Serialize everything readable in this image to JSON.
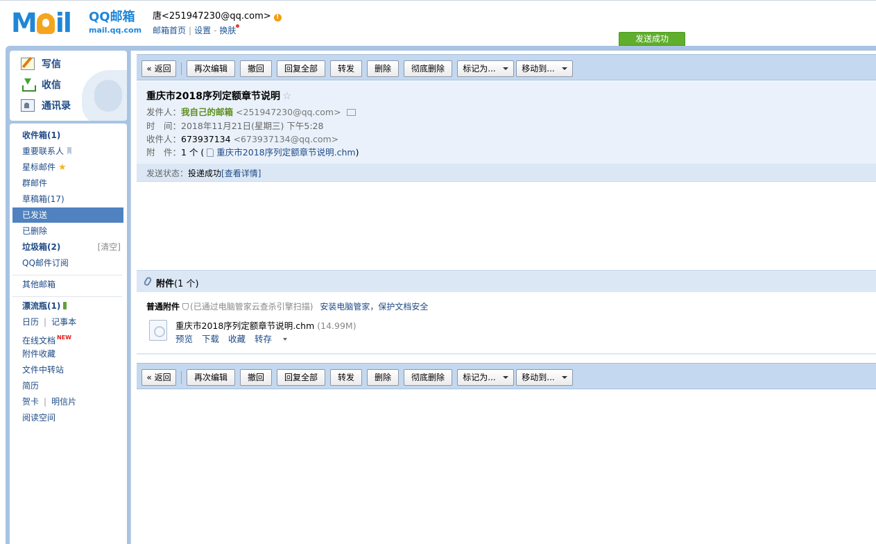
{
  "header": {
    "logo_text": "MOil",
    "brand_name": "QQ邮箱",
    "brand_domain": "mail.qq.com",
    "user": "唐<251947230@qq.com>",
    "links": [
      "邮箱首页",
      "设置",
      "换肤"
    ],
    "link_sep": "|",
    "link_dash": "-",
    "toast": "发送成功"
  },
  "sidebar": {
    "main_actions": [
      "写信",
      "收信",
      "通讯录"
    ],
    "folders": {
      "inbox": "收件箱(1)",
      "vip": "重要联系人",
      "starred": "星标邮件",
      "group": "群邮件",
      "drafts": "草稿箱(17)",
      "sent": "已发送",
      "deleted": "已删除",
      "spam": "垃圾箱(2)",
      "spam_clear": "[清空]",
      "subscribe": "QQ邮件订阅",
      "other": "其他邮箱",
      "bottle": "漂流瓶(1)",
      "calendar": "日历",
      "notes": "记事本",
      "docs": "在线文档",
      "docs_badge": "NEW",
      "att_fav": "附件收藏",
      "transfer": "文件中转站",
      "resume": "简历",
      "card": "贺卡",
      "postcard": "明信片",
      "reading": "阅读空间"
    }
  },
  "toolbar": {
    "back": "« 返回",
    "reedit": "再次编辑",
    "recall": "撤回",
    "reply_all": "回复全部",
    "forward": "转发",
    "delete": "删除",
    "delete_perm": "彻底删除",
    "mark_as": "标记为...",
    "move_to": "移动到..."
  },
  "mail": {
    "subject": "重庆市2018序列定额章节说明",
    "star": "☆",
    "from_label": "发件人：",
    "from_name": "我自己的邮箱",
    "from_addr": "<251947230@qq.com>",
    "time_label": "时　间：",
    "time": "2018年11月21日(星期三) 下午5:28",
    "to_label": "收件人：",
    "to_name": "673937134",
    "to_addr": "<673937134@qq.com>",
    "att_label": "附　件：",
    "att_count_prefix": "1 个 (",
    "att_file": "重庆市2018序列定额章节说明.chm",
    "att_count_suffix": ")",
    "status_label": "发送状态：",
    "status_value": "投递成功",
    "status_link": "[查看详情]"
  },
  "attachments": {
    "title": "附件",
    "count": "(1 个)",
    "type": "普通附件",
    "scan_note": "(已通过电脑管家云查杀引擎扫描)",
    "promo": "安装电脑管家，保护文档安全",
    "file_name": "重庆市2018序列定额章节说明.chm",
    "file_size": "(14.99M)",
    "actions": [
      "预览",
      "下载",
      "收藏",
      "转存"
    ]
  }
}
